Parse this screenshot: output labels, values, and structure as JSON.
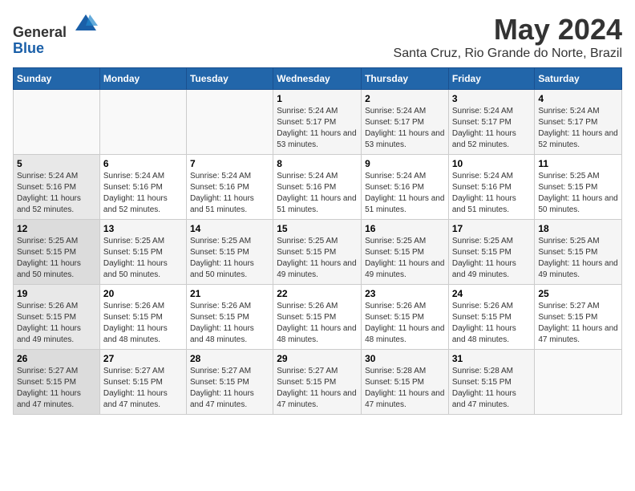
{
  "header": {
    "logo_line1": "General",
    "logo_line2": "Blue",
    "month_title": "May 2024",
    "location": "Santa Cruz, Rio Grande do Norte, Brazil"
  },
  "days_of_week": [
    "Sunday",
    "Monday",
    "Tuesday",
    "Wednesday",
    "Thursday",
    "Friday",
    "Saturday"
  ],
  "weeks": [
    [
      {
        "day": "",
        "info": ""
      },
      {
        "day": "",
        "info": ""
      },
      {
        "day": "",
        "info": ""
      },
      {
        "day": "1",
        "info": "Sunrise: 5:24 AM\nSunset: 5:17 PM\nDaylight: 11 hours and 53 minutes."
      },
      {
        "day": "2",
        "info": "Sunrise: 5:24 AM\nSunset: 5:17 PM\nDaylight: 11 hours and 53 minutes."
      },
      {
        "day": "3",
        "info": "Sunrise: 5:24 AM\nSunset: 5:17 PM\nDaylight: 11 hours and 52 minutes."
      },
      {
        "day": "4",
        "info": "Sunrise: 5:24 AM\nSunset: 5:17 PM\nDaylight: 11 hours and 52 minutes."
      }
    ],
    [
      {
        "day": "5",
        "info": "Sunrise: 5:24 AM\nSunset: 5:16 PM\nDaylight: 11 hours and 52 minutes."
      },
      {
        "day": "6",
        "info": "Sunrise: 5:24 AM\nSunset: 5:16 PM\nDaylight: 11 hours and 52 minutes."
      },
      {
        "day": "7",
        "info": "Sunrise: 5:24 AM\nSunset: 5:16 PM\nDaylight: 11 hours and 51 minutes."
      },
      {
        "day": "8",
        "info": "Sunrise: 5:24 AM\nSunset: 5:16 PM\nDaylight: 11 hours and 51 minutes."
      },
      {
        "day": "9",
        "info": "Sunrise: 5:24 AM\nSunset: 5:16 PM\nDaylight: 11 hours and 51 minutes."
      },
      {
        "day": "10",
        "info": "Sunrise: 5:24 AM\nSunset: 5:16 PM\nDaylight: 11 hours and 51 minutes."
      },
      {
        "day": "11",
        "info": "Sunrise: 5:25 AM\nSunset: 5:15 PM\nDaylight: 11 hours and 50 minutes."
      }
    ],
    [
      {
        "day": "12",
        "info": "Sunrise: 5:25 AM\nSunset: 5:15 PM\nDaylight: 11 hours and 50 minutes."
      },
      {
        "day": "13",
        "info": "Sunrise: 5:25 AM\nSunset: 5:15 PM\nDaylight: 11 hours and 50 minutes."
      },
      {
        "day": "14",
        "info": "Sunrise: 5:25 AM\nSunset: 5:15 PM\nDaylight: 11 hours and 50 minutes."
      },
      {
        "day": "15",
        "info": "Sunrise: 5:25 AM\nSunset: 5:15 PM\nDaylight: 11 hours and 49 minutes."
      },
      {
        "day": "16",
        "info": "Sunrise: 5:25 AM\nSunset: 5:15 PM\nDaylight: 11 hours and 49 minutes."
      },
      {
        "day": "17",
        "info": "Sunrise: 5:25 AM\nSunset: 5:15 PM\nDaylight: 11 hours and 49 minutes."
      },
      {
        "day": "18",
        "info": "Sunrise: 5:25 AM\nSunset: 5:15 PM\nDaylight: 11 hours and 49 minutes."
      }
    ],
    [
      {
        "day": "19",
        "info": "Sunrise: 5:26 AM\nSunset: 5:15 PM\nDaylight: 11 hours and 49 minutes."
      },
      {
        "day": "20",
        "info": "Sunrise: 5:26 AM\nSunset: 5:15 PM\nDaylight: 11 hours and 48 minutes."
      },
      {
        "day": "21",
        "info": "Sunrise: 5:26 AM\nSunset: 5:15 PM\nDaylight: 11 hours and 48 minutes."
      },
      {
        "day": "22",
        "info": "Sunrise: 5:26 AM\nSunset: 5:15 PM\nDaylight: 11 hours and 48 minutes."
      },
      {
        "day": "23",
        "info": "Sunrise: 5:26 AM\nSunset: 5:15 PM\nDaylight: 11 hours and 48 minutes."
      },
      {
        "day": "24",
        "info": "Sunrise: 5:26 AM\nSunset: 5:15 PM\nDaylight: 11 hours and 48 minutes."
      },
      {
        "day": "25",
        "info": "Sunrise: 5:27 AM\nSunset: 5:15 PM\nDaylight: 11 hours and 47 minutes."
      }
    ],
    [
      {
        "day": "26",
        "info": "Sunrise: 5:27 AM\nSunset: 5:15 PM\nDaylight: 11 hours and 47 minutes."
      },
      {
        "day": "27",
        "info": "Sunrise: 5:27 AM\nSunset: 5:15 PM\nDaylight: 11 hours and 47 minutes."
      },
      {
        "day": "28",
        "info": "Sunrise: 5:27 AM\nSunset: 5:15 PM\nDaylight: 11 hours and 47 minutes."
      },
      {
        "day": "29",
        "info": "Sunrise: 5:27 AM\nSunset: 5:15 PM\nDaylight: 11 hours and 47 minutes."
      },
      {
        "day": "30",
        "info": "Sunrise: 5:28 AM\nSunset: 5:15 PM\nDaylight: 11 hours and 47 minutes."
      },
      {
        "day": "31",
        "info": "Sunrise: 5:28 AM\nSunset: 5:15 PM\nDaylight: 11 hours and 47 minutes."
      },
      {
        "day": "",
        "info": ""
      }
    ]
  ]
}
